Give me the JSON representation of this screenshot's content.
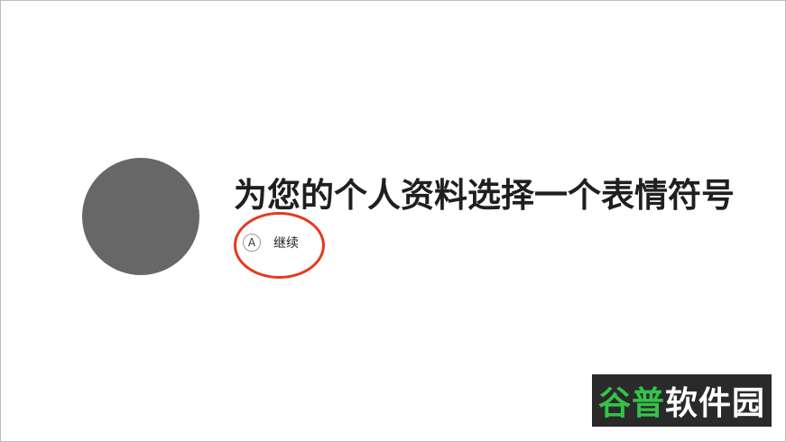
{
  "profile": {
    "title": "为您的个人资料选择一个表情符号"
  },
  "actions": {
    "continue_key": "A",
    "continue_label": "继续"
  },
  "watermark": {
    "brand_part1": "谷普",
    "brand_part2": "软件园"
  },
  "colors": {
    "avatar": "#676767",
    "highlight_ring": "#e33b1f",
    "watermark_green": "#35c24a"
  }
}
